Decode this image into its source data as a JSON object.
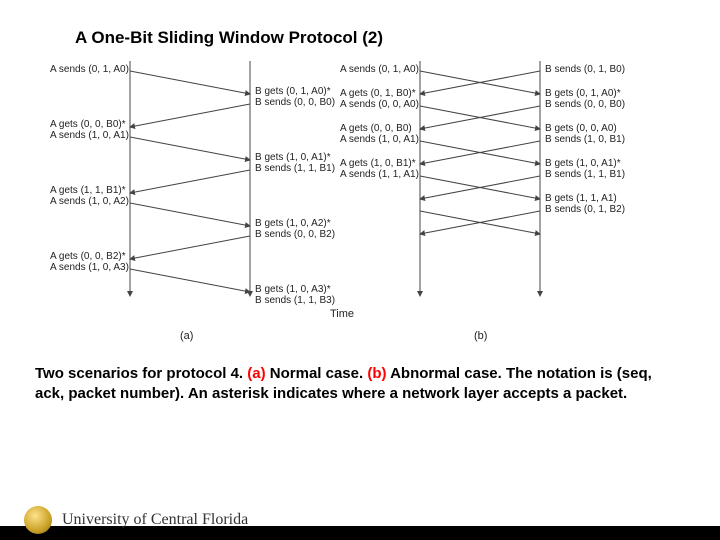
{
  "title": "A One-Bit Sliding Window Protocol (2)",
  "caption": {
    "lead": "Two scenarios for protocol 4. ",
    "a": "(a)",
    "a_text": " Normal case. ",
    "b": "(b)",
    "b_text": " Abnormal case. The notation is (seq, ack, packet number).  An asterisk indicates where a network layer accepts a packet."
  },
  "axis_label": "Time",
  "panel_a_label": "(a)",
  "panel_b_label": "(b)",
  "footer": {
    "university": "University of Central Florida"
  },
  "a": {
    "l1": "A sends (0, 1, A0)",
    "r1a": "B gets (0, 1, A0)*",
    "r1b": "B sends (0, 0, B0)",
    "l2a": "A gets (0, 0, B0)*",
    "l2b": "A sends (1, 0, A1)",
    "r2a": "B gets (1, 0, A1)*",
    "r2b": "B sends (1, 1, B1)",
    "l3a": "A gets (1, 1, B1)*",
    "l3b": "A sends (1, 0, A2)",
    "r3a": "B gets (1, 0, A2)*",
    "r3b": "B sends (0, 0, B2)",
    "l4a": "A gets (0, 0, B2)*",
    "l4b": "A sends (1, 0, A3)",
    "r4a": "B gets (1, 0, A3)*",
    "r4b": "B sends (1, 1, B3)"
  },
  "b": {
    "l1": "A sends (0, 1, A0)",
    "r1": "B sends (0, 1, B0)",
    "r2a": "B gets (0, 1, A0)*",
    "r2b": "B sends (0, 0, B0)",
    "l2a": "A gets (0, 1, B0)*",
    "l2b": "A sends (0, 0, A0)",
    "r3a": "B gets (0, 0, A0)",
    "r3b": "B sends (1, 0, B1)",
    "l3a": "A gets (0, 0, B0)",
    "l3b": "A sends (1, 0, A1)",
    "r4a": "B gets (1, 0, A1)*",
    "r4b": "B sends (1, 1, B1)",
    "l4a": "A gets (1, 0, B1)*",
    "l4b": "A sends (1, 1, A1)",
    "r5a": "B gets (1, 1, A1)",
    "r5b": "B sends (0, 1, B2)"
  }
}
